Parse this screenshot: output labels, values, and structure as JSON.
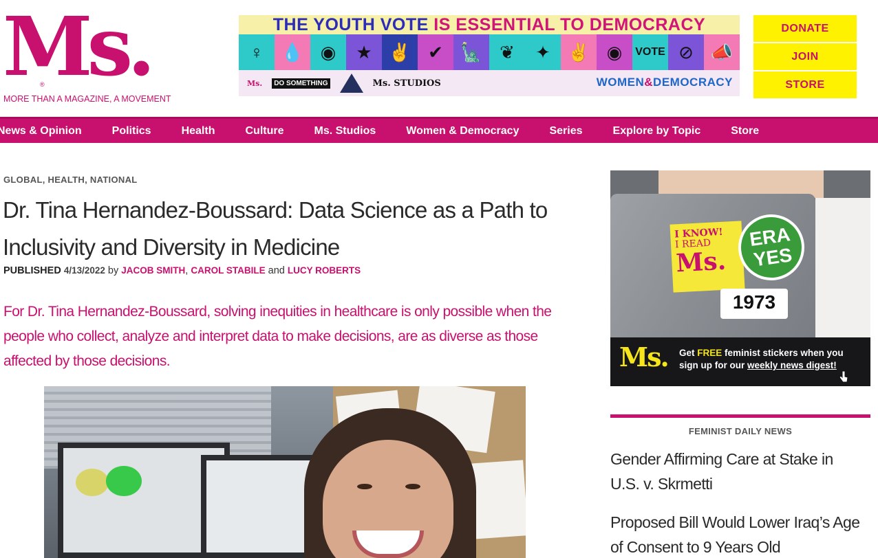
{
  "header": {
    "logo_text": "Ms.",
    "logo_reg": "®",
    "tagline": "MORE THAN A MAGAZINE, A MOVEMENT",
    "buttons": {
      "donate": "DONATE",
      "join": "JOIN",
      "store": "STORE"
    }
  },
  "banner": {
    "headline_part1": "THE YOUTH VOTE",
    "headline_part2": " IS ESSENTIAL TO DEMOCRACY",
    "sponsors": {
      "ms_magazine": "Ms.",
      "do_something": "DO SOMETHING",
      "ms_studios": "Ms. STUDIOS"
    },
    "women_democracy_1": "WOMEN",
    "women_democracy_amp": "&",
    "women_democracy_2": "DEMOCRACY",
    "tile_colors": [
      "#2ec9c9",
      "#f37ab5",
      "#2ec9c9",
      "#7b54d8",
      "#2c3ea8",
      "#c84ec8",
      "#7b54d8",
      "#2ec9c9",
      "#2ec9c9",
      "#f37ab5",
      "#c84ec8",
      "#2ec9c9",
      "#7b54d8",
      "#f37ab5"
    ],
    "tile_icons": [
      "♀",
      "💧",
      "◉",
      "★",
      "✌",
      "✔",
      "🗽",
      "❦",
      "✦",
      "✌",
      "◉",
      "VOTE",
      "⊘",
      "📣"
    ]
  },
  "nav": {
    "items": [
      "News & Opinion",
      "Politics",
      "Health",
      "Culture",
      "Ms. Studios",
      "Women & Democracy",
      "Series",
      "Explore by Topic",
      "Store"
    ]
  },
  "article": {
    "categories": [
      "GLOBAL",
      "HEALTH",
      "NATIONAL"
    ],
    "title": "Dr. Tina Hernandez-Boussard: Data Science as a Path to Inclusivity and Diversity in Medicine",
    "published_label": "PUBLISHED",
    "date": "4/13/2022",
    "by": "by",
    "authors": [
      "JACOB SMITH",
      "CAROL STABILE",
      "LUCY ROBERTS"
    ],
    "and": "and",
    "dek": "For Dr. Tina Hernandez-Boussard, solving inequities in healthcare is only possible when the people who collect, analyze and interpret data to make decisions, are as diverse as those affected by those decisions."
  },
  "sidebar": {
    "promo": {
      "sticker1_line1": "I KNOW!",
      "sticker1_line2": "I READ",
      "sticker1_line3": "Ms.",
      "sticker2": "ERA YES",
      "sticker3": "1973",
      "ms_logo": "Ms.",
      "text_1": "Get ",
      "text_free": "FREE",
      "text_2": " feminist stickers when you sign up for our ",
      "text_link": "weekly news digest!"
    },
    "news_heading": "FEMINIST DAILY NEWS",
    "news_items": [
      "Gender Affirming Care at Stake in U.S. v. Skrmetti",
      "Proposed Bill Would Lower Iraq’s Age of Consent to 9 Years Old"
    ]
  },
  "colors": {
    "brand_pink": "#c8106e",
    "cta_yellow": "#fff200"
  }
}
